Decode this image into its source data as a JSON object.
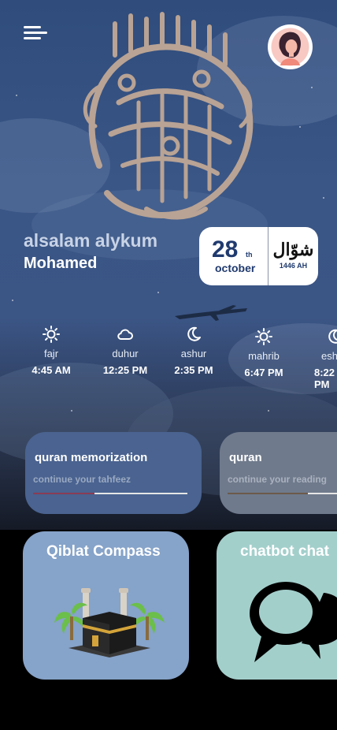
{
  "header": {
    "menu_icon": "hamburger-menu-icon",
    "avatar_icon": "user-avatar-icon"
  },
  "greeting": {
    "salutation": "alsalam alykum",
    "name": "Mohamed"
  },
  "date": {
    "day": "28",
    "day_suffix": "th",
    "month": "october",
    "hijri_month": "شوّال",
    "hijri_year": "1446 AH"
  },
  "prayers": [
    {
      "name": "fajr",
      "time": "4:45 AM",
      "icon": "sun-icon"
    },
    {
      "name": "duhur",
      "time": "12:25 PM",
      "icon": "cloud-icon"
    },
    {
      "name": "ashur",
      "time": "2:35 PM",
      "icon": "moon-icon"
    },
    {
      "name": "mahrib",
      "time": "6:47 PM",
      "icon": "sun-icon"
    },
    {
      "name": "esha",
      "time": "8:22 PM",
      "icon": "moon-icon"
    }
  ],
  "progress_cards": [
    {
      "title": "quran memorization",
      "subtitle": "continue your tahfeez",
      "progress": 0.4,
      "color": "#4a6390",
      "accent": "#8a3c55"
    },
    {
      "title": "quran",
      "subtitle": "continue your reading",
      "progress": 0.73,
      "color": "#6f7a8c",
      "accent": "#6b5a4a"
    }
  ],
  "feature_cards": [
    {
      "title": "Qiblat  Compass",
      "color": "#86a3c9",
      "icon": "kaaba-icon"
    },
    {
      "title": "chatbot chat",
      "color": "#a3cfcb",
      "icon": "speech-bubbles-icon"
    }
  ],
  "colors": {
    "primary": "#1f3a6e",
    "background": "#000000"
  }
}
